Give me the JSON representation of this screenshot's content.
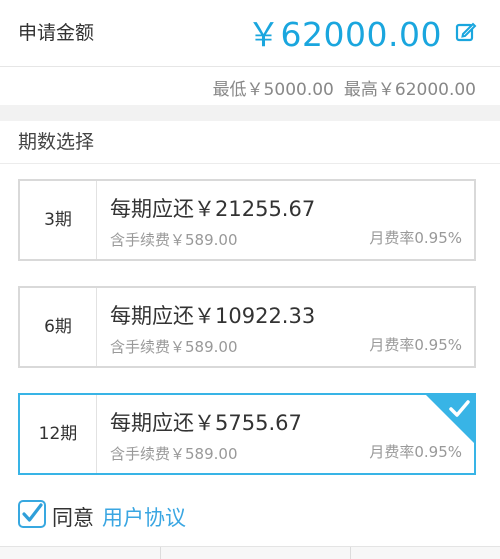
{
  "header": {
    "label": "申请金额",
    "amount": "￥62000.00",
    "edit_icon": "edit-icon"
  },
  "range": {
    "min": "最低￥5000.00",
    "max": "最高￥62000.00"
  },
  "section": {
    "title": "期数选择"
  },
  "plans": [
    {
      "period": "3期",
      "payment": "每期应还￥21255.67",
      "fee": "含手续费￥589.00",
      "rate": "月费率0.95%",
      "selected": false
    },
    {
      "period": "6期",
      "payment": "每期应还￥10922.33",
      "fee": "含手续费￥589.00",
      "rate": "月费率0.95%",
      "selected": false
    },
    {
      "period": "12期",
      "payment": "每期应还￥5755.67",
      "fee": "含手续费￥589.00",
      "rate": "月费率0.95%",
      "selected": true
    }
  ],
  "agreement": {
    "checked": true,
    "text": "同意",
    "link": "用户协议"
  },
  "colors": {
    "accent": "#1aa6de",
    "selected_border": "#38b4e6",
    "muted": "#999999"
  }
}
